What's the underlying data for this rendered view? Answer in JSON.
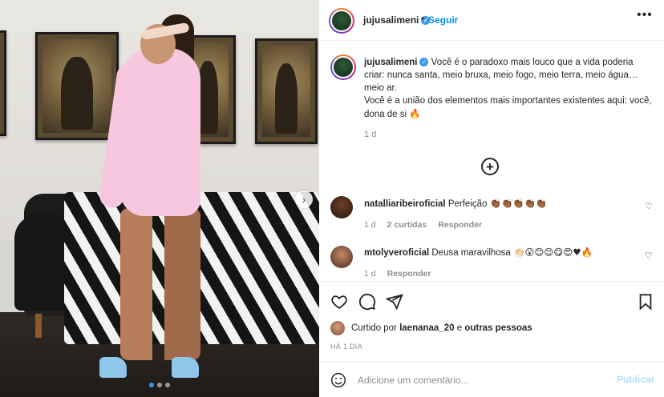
{
  "post": {
    "username": "jujusalimeni",
    "verified": true,
    "follow_label": "Seguir",
    "separator": "•",
    "more_glyph": "•••",
    "caption": {
      "line1": "Você é o paradoxo mais louco que a vida poderia criar: nunca santa, meio bruxa, meio fogo, meio terra, meio água… meio ar.",
      "line2": "Você é a união dos elementos mais importantes existentes aqui: você, dona de si",
      "emoji": "🔥",
      "time": "1 d"
    },
    "media": {
      "next_glyph": "›",
      "dots": 3,
      "active_dot": 0
    }
  },
  "comments": [
    {
      "username": "natalliaribeiroficial",
      "text": "Perfeição",
      "emojis": "👏🏾👏🏾👏🏾👏🏾👏🏾",
      "time": "1 d",
      "likes": "2 curtidas",
      "reply": "Responder"
    },
    {
      "username": "mtolyveroficial",
      "text": "Deusa maravilhosa",
      "emojis": "👏🏻😮😊😌😋😍♥🔥",
      "time": "1 d",
      "reply": "Responder"
    }
  ],
  "likes": {
    "prefix": "Curtido por",
    "user": "laenanaa_20",
    "connector": "e",
    "others": "outras pessoas"
  },
  "date_label": "HÁ 1 DIA",
  "comment_box": {
    "placeholder": "Adicione um comentário...",
    "publish_label": "Publicar"
  },
  "icons": {
    "verified": "verified-badge-icon",
    "load_more": "plus-circle-icon",
    "like": "heart-icon",
    "comment": "speech-bubble-icon",
    "share": "paper-plane-icon",
    "save": "bookmark-icon",
    "emoji": "smiley-icon",
    "next": "chevron-right-icon"
  },
  "colors": {
    "accent": "#0095f6",
    "verified": "#3897f0",
    "muted": "#8e8e8e",
    "publish_disabled": "#b2dffc",
    "dress": "#f7c7df",
    "carousel_active_dot": "#3a8ef6"
  }
}
